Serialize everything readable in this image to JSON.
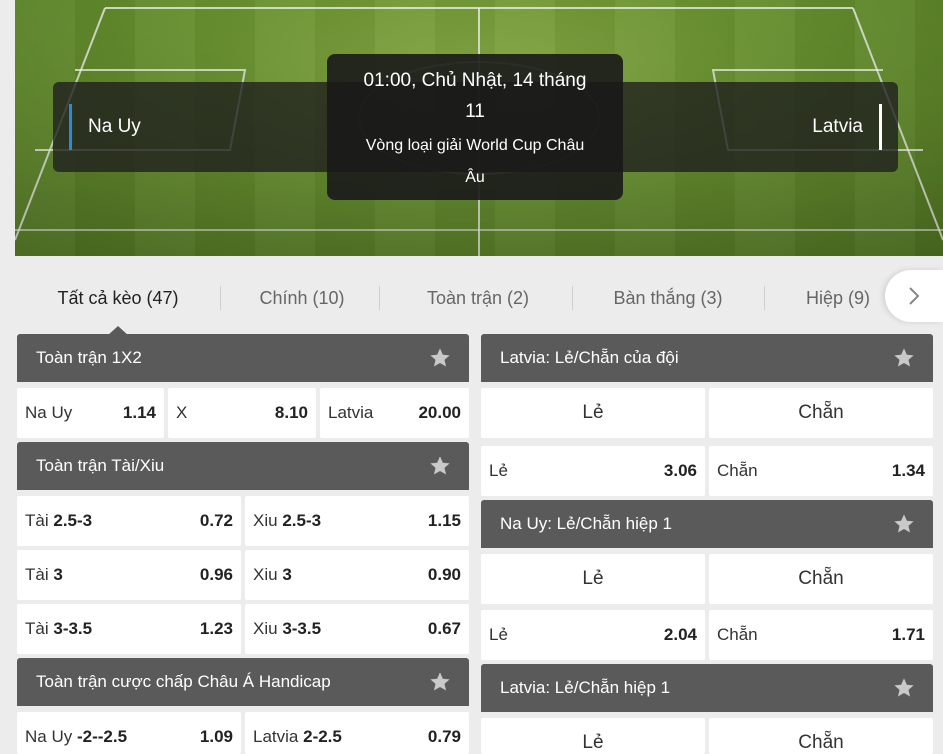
{
  "header": {
    "home_team": "Na Uy",
    "away_team": "Latvia",
    "kickoff_line1": "01:00, Chủ Nhật, 14 tháng",
    "kickoff_line2": "11",
    "league_line1": "Vòng loại giải World Cup Châu",
    "league_line2": "Âu",
    "colors": {
      "home_accent": "#2a8bd8",
      "away_accent": "#ffffff"
    }
  },
  "tabs": [
    {
      "label": "Tất cả kèo (47)",
      "active": true
    },
    {
      "label": "Chính (10)"
    },
    {
      "label": "Toàn trận (2)"
    },
    {
      "label": "Bàn thắng (3)"
    },
    {
      "label": "Hiệp (9)"
    }
  ],
  "tabs_next_icon": "chevron-right-icon",
  "markets": {
    "m1x2": {
      "title": "Toàn trận 1X2",
      "cells": [
        {
          "label": "Na Uy",
          "odd": "1.14"
        },
        {
          "label": "X",
          "odd": "8.10"
        },
        {
          "label": "Latvia",
          "odd": "20.00"
        }
      ]
    },
    "ou": {
      "title": "Toàn trận Tài/Xiu",
      "rows": [
        [
          {
            "label": "Tài",
            "line": "2.5-3",
            "odd": "0.72"
          },
          {
            "label": "Xiu",
            "line": "2.5-3",
            "odd": "1.15"
          }
        ],
        [
          {
            "label": "Tài",
            "line": "3",
            "odd": "0.96"
          },
          {
            "label": "Xiu",
            "line": "3",
            "odd": "0.90"
          }
        ],
        [
          {
            "label": "Tài",
            "line": "3-3.5",
            "odd": "1.23"
          },
          {
            "label": "Xiu",
            "line": "3-3.5",
            "odd": "0.67"
          }
        ]
      ]
    },
    "ah": {
      "title": "Toàn trận cược chấp Châu Á Handicap",
      "cells": [
        {
          "label": "Na Uy",
          "line": "-2--2.5",
          "odd": "1.09"
        },
        {
          "label": "Latvia",
          "line": "2-2.5",
          "odd": "0.79"
        }
      ]
    },
    "lat_oe": {
      "title": "Latvia: Lẻ/Chẵn của đội",
      "head_cells": [
        "Lẻ",
        "Chẵn"
      ],
      "cells": [
        {
          "label": "Lẻ",
          "odd": "3.06"
        },
        {
          "label": "Chẵn",
          "odd": "1.34"
        }
      ]
    },
    "nor_oe1": {
      "title": "Na Uy: Lẻ/Chẵn hiệp 1",
      "head_cells": [
        "Lẻ",
        "Chẵn"
      ],
      "cells": [
        {
          "label": "Lẻ",
          "odd": "2.04"
        },
        {
          "label": "Chẵn",
          "odd": "1.71"
        }
      ]
    },
    "lat_oe1": {
      "title": "Latvia: Lẻ/Chẵn hiệp 1",
      "head_cells": [
        "Lẻ",
        "Chẵn"
      ]
    }
  },
  "star_icon": "star-icon"
}
